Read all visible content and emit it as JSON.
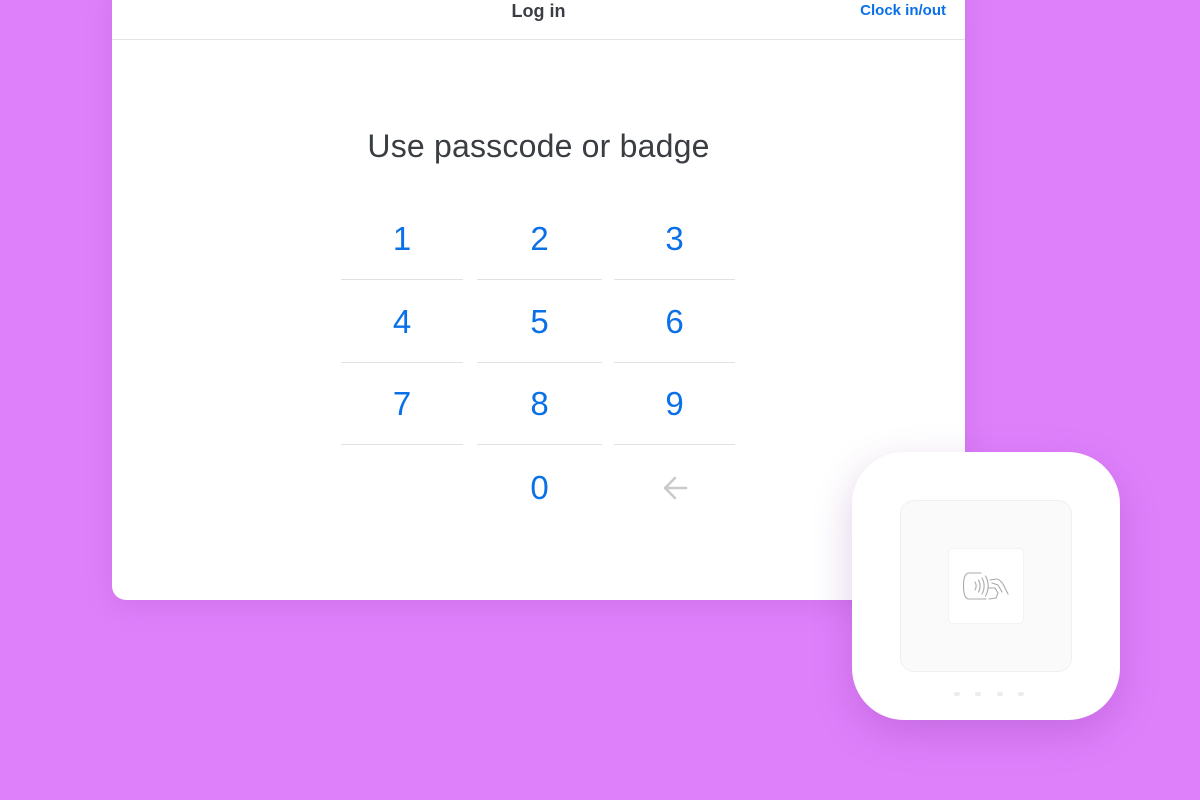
{
  "header": {
    "title": "Log in",
    "clock_link": "Clock in/out"
  },
  "prompt": "Use passcode or badge",
  "keypad": {
    "k1": "1",
    "k2": "2",
    "k3": "3",
    "k4": "4",
    "k5": "5",
    "k6": "6",
    "k7": "7",
    "k8": "8",
    "k9": "9",
    "k0": "0",
    "backspace_icon": "arrow-left-icon"
  },
  "reader": {
    "icon": "contactless-tap-icon",
    "indicator_count": 4
  },
  "colors": {
    "background": "#df80fb",
    "accent": "#0a70e8",
    "text": "#3a3d42",
    "disabled": "#c9cacd"
  }
}
